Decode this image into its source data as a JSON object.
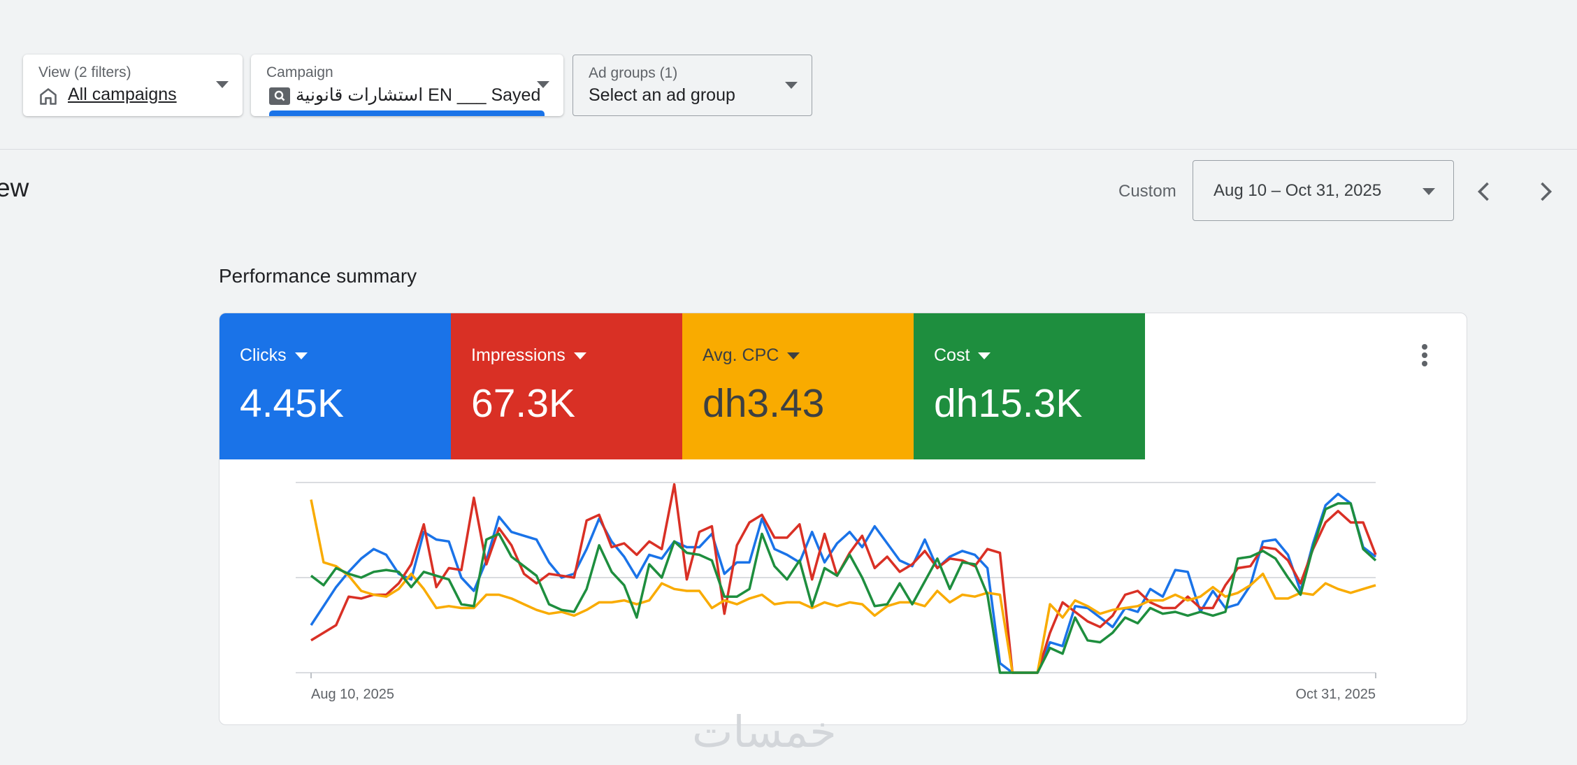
{
  "filters": {
    "view": {
      "label": "View (2 filters)",
      "value": "All campaigns"
    },
    "campaign": {
      "label": "Campaign",
      "value": "استشارات قانونية EN ___ Sayed"
    },
    "adgroup": {
      "label": "Ad groups (1)",
      "value": "Select an ad group"
    }
  },
  "page": {
    "heading_fragment": "ew",
    "custom_label": "Custom",
    "date_range": "Aug 10 – Oct 31, 2025"
  },
  "summary": {
    "title": "Performance summary",
    "metrics": [
      {
        "label": "Clicks",
        "value": "4.45K",
        "color": "#1a73e8"
      },
      {
        "label": "Impressions",
        "value": "67.3K",
        "color": "#d93025"
      },
      {
        "label": "Avg. CPC",
        "value": "dh3.43",
        "color": "#f9ab00"
      },
      {
        "label": "Cost",
        "value": "dh15.3K",
        "color": "#1e8e3e"
      }
    ]
  },
  "watermark": "خمسات",
  "chart_data": {
    "type": "line",
    "x_start_label": "Aug 10, 2025",
    "x_end_label": "Oct 31, 2025",
    "x": [
      "Aug 10, 2025",
      "Oct 31, 2025"
    ],
    "grid": true,
    "series": [
      {
        "color": "#1a73e8",
        "values": [
          0.25,
          0.35,
          0.45,
          0.53,
          0.6,
          0.65,
          0.62,
          0.52,
          0.49,
          0.74,
          0.7,
          0.69,
          0.5,
          0.43,
          0.59,
          0.82,
          0.74,
          0.72,
          0.7,
          0.58,
          0.5,
          0.52,
          0.65,
          0.81,
          0.69,
          0.61,
          0.5,
          0.62,
          0.6,
          0.69,
          0.66,
          0.66,
          0.73,
          0.52,
          0.58,
          0.58,
          0.81,
          0.65,
          0.62,
          0.58,
          0.74,
          0.58,
          0.68,
          0.74,
          0.66,
          0.77,
          0.68,
          0.59,
          0.56,
          0.7,
          0.55,
          0.61,
          0.64,
          0.62,
          0.55,
          0.05,
          0.0,
          0.0,
          0.0,
          0.16,
          0.14,
          0.35,
          0.34,
          0.29,
          0.24,
          0.34,
          0.32,
          0.44,
          0.4,
          0.54,
          0.53,
          0.32,
          0.43,
          0.34,
          0.36,
          0.46,
          0.69,
          0.7,
          0.62,
          0.43,
          0.68,
          0.88,
          0.94,
          0.89,
          0.66,
          0.61
        ]
      },
      {
        "color": "#d93025",
        "values": [
          0.17,
          0.21,
          0.25,
          0.4,
          0.39,
          0.41,
          0.41,
          0.47,
          0.57,
          0.78,
          0.45,
          0.55,
          0.54,
          0.92,
          0.57,
          0.76,
          0.67,
          0.52,
          0.47,
          0.52,
          0.51,
          0.5,
          0.8,
          0.83,
          0.66,
          0.68,
          0.62,
          0.69,
          0.65,
          0.99,
          0.49,
          0.74,
          0.77,
          0.31,
          0.67,
          0.79,
          0.83,
          0.71,
          0.71,
          0.78,
          0.49,
          0.73,
          0.51,
          0.63,
          0.72,
          0.55,
          0.61,
          0.53,
          0.57,
          0.64,
          0.55,
          0.6,
          0.59,
          0.56,
          0.65,
          0.63,
          0.0,
          0.0,
          0.0,
          0.21,
          0.37,
          0.32,
          0.27,
          0.24,
          0.3,
          0.41,
          0.43,
          0.37,
          0.34,
          0.34,
          0.4,
          0.34,
          0.34,
          0.46,
          0.55,
          0.56,
          0.66,
          0.65,
          0.59,
          0.47,
          0.65,
          0.79,
          0.85,
          0.79,
          0.79,
          0.62
        ]
      },
      {
        "color": "#f9ab00",
        "values": [
          0.91,
          0.58,
          0.56,
          0.51,
          0.43,
          0.41,
          0.4,
          0.44,
          0.52,
          0.44,
          0.34,
          0.35,
          0.34,
          0.34,
          0.41,
          0.41,
          0.39,
          0.36,
          0.33,
          0.31,
          0.32,
          0.3,
          0.33,
          0.37,
          0.37,
          0.38,
          0.36,
          0.38,
          0.47,
          0.44,
          0.43,
          0.43,
          0.34,
          0.38,
          0.36,
          0.39,
          0.41,
          0.36,
          0.37,
          0.37,
          0.34,
          0.37,
          0.35,
          0.37,
          0.36,
          0.3,
          0.35,
          0.37,
          0.37,
          0.35,
          0.43,
          0.37,
          0.41,
          0.4,
          0.42,
          0.41,
          0.0,
          0.0,
          0.0,
          0.36,
          0.29,
          0.38,
          0.35,
          0.31,
          0.33,
          0.34,
          0.35,
          0.38,
          0.38,
          0.41,
          0.38,
          0.4,
          0.45,
          0.4,
          0.42,
          0.46,
          0.52,
          0.39,
          0.39,
          0.42,
          0.41,
          0.47,
          0.44,
          0.42,
          0.44,
          0.46
        ]
      },
      {
        "color": "#1e8e3e",
        "values": [
          0.51,
          0.46,
          0.55,
          0.52,
          0.5,
          0.53,
          0.54,
          0.53,
          0.45,
          0.53,
          0.51,
          0.49,
          0.36,
          0.35,
          0.7,
          0.73,
          0.61,
          0.56,
          0.51,
          0.36,
          0.33,
          0.32,
          0.44,
          0.67,
          0.53,
          0.46,
          0.29,
          0.57,
          0.5,
          0.69,
          0.63,
          0.62,
          0.59,
          0.4,
          0.4,
          0.44,
          0.73,
          0.56,
          0.49,
          0.59,
          0.35,
          0.55,
          0.51,
          0.62,
          0.5,
          0.35,
          0.36,
          0.47,
          0.36,
          0.48,
          0.6,
          0.44,
          0.58,
          0.57,
          0.41,
          0.0,
          0.0,
          0.0,
          0.0,
          0.13,
          0.1,
          0.29,
          0.17,
          0.16,
          0.21,
          0.29,
          0.26,
          0.34,
          0.31,
          0.32,
          0.3,
          0.32,
          0.3,
          0.32,
          0.6,
          0.61,
          0.64,
          0.6,
          0.5,
          0.41,
          0.66,
          0.86,
          0.89,
          0.89,
          0.65,
          0.59
        ]
      }
    ]
  }
}
